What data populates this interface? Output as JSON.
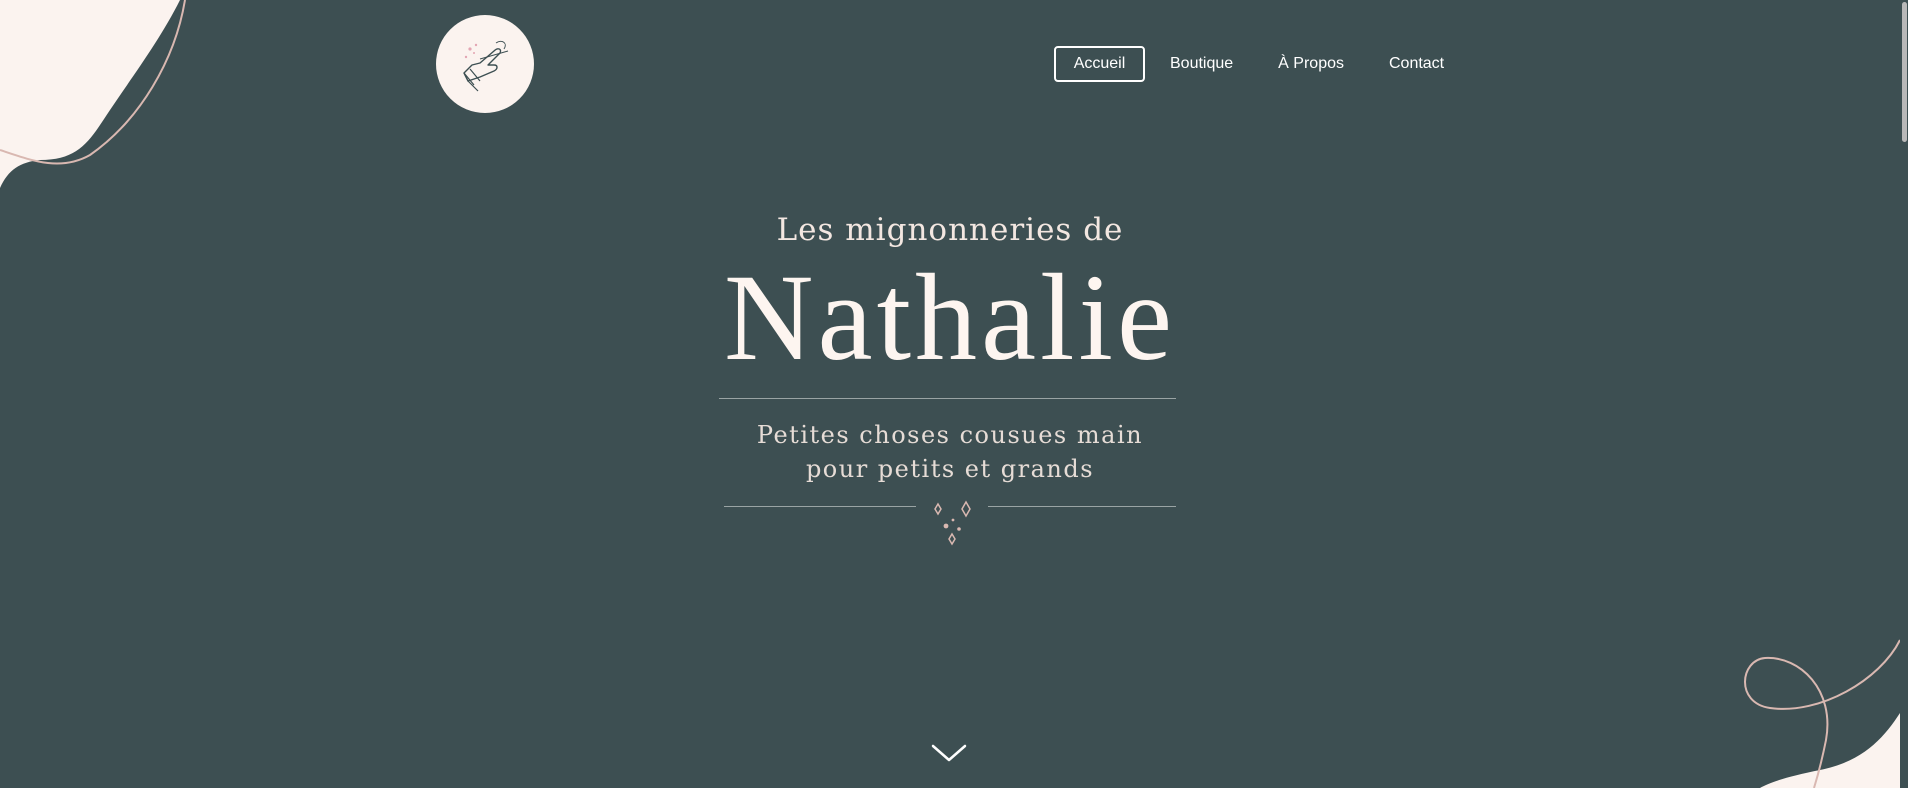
{
  "nav": {
    "items": [
      {
        "label": "Accueil",
        "active": true
      },
      {
        "label": "Boutique",
        "active": false
      },
      {
        "label": "À Propos",
        "active": false
      },
      {
        "label": "Contact",
        "active": false
      }
    ]
  },
  "hero": {
    "pretitle": "Les mignonneries de",
    "name": "Nathalie",
    "tagline_line1": "Petites choses cousues main",
    "tagline_line2": "pour petits et grands"
  },
  "icons": {
    "logo": "hand-sewing-needle-icon",
    "ornament": "sparkle-icon",
    "scroll": "chevron-down-icon"
  },
  "colors": {
    "background": "#3d4f52",
    "cream": "#fbf3ef",
    "accent_pink": "#d9b8b1",
    "text_light": "#fdf5f0"
  }
}
